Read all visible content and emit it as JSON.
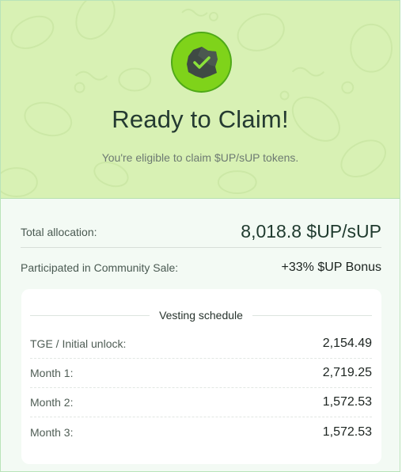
{
  "hero": {
    "badge_icon": "check-badge-icon",
    "title": "Ready to Claim!",
    "subtitle": "You're eligible to claim $UP/sUP tokens.",
    "colors": {
      "hero_bg": "#d8f1b4",
      "badge_bg": "#7fd31a",
      "badge_shape": "#3f4a44",
      "check": "#8be23a"
    }
  },
  "allocation": {
    "label": "Total allocation:",
    "value": "8,018.8 $UP/sUP"
  },
  "participation": {
    "label": "Participated in Community Sale:",
    "value": "+33% $UP Bonus"
  },
  "vesting": {
    "title": "Vesting schedule",
    "rows": [
      {
        "label": "TGE / Initial unlock:",
        "value": "2,154.49"
      },
      {
        "label": "Month 1:",
        "value": "2,719.25"
      },
      {
        "label": "Month 2:",
        "value": "1,572.53"
      },
      {
        "label": "Month 3:",
        "value": "1,572.53"
      }
    ]
  }
}
